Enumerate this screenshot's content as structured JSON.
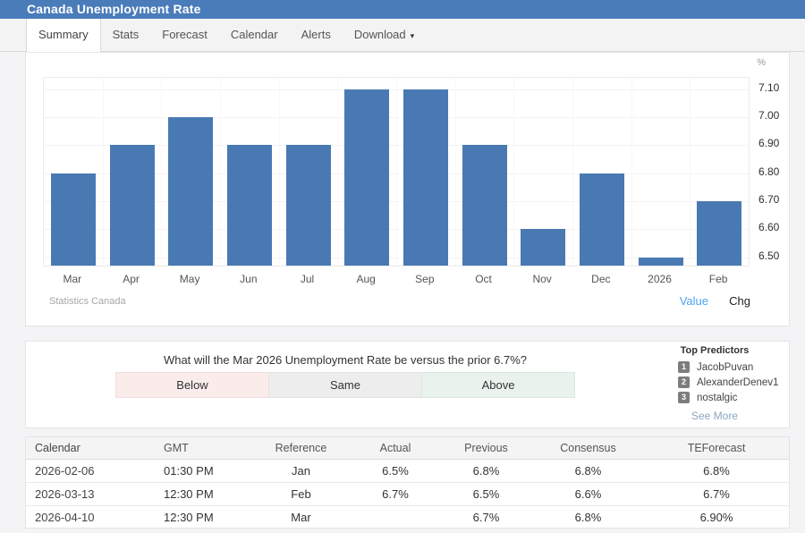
{
  "header": {
    "title": "Canada Unemployment Rate"
  },
  "tabs": [
    {
      "label": "Summary",
      "active": true,
      "has_dropdown": false
    },
    {
      "label": "Stats",
      "active": false,
      "has_dropdown": false
    },
    {
      "label": "Forecast",
      "active": false,
      "has_dropdown": false
    },
    {
      "label": "Calendar",
      "active": false,
      "has_dropdown": false
    },
    {
      "label": "Alerts",
      "active": false,
      "has_dropdown": false
    },
    {
      "label": "Download",
      "active": false,
      "has_dropdown": true
    }
  ],
  "chart_data": {
    "type": "bar",
    "title": "Canada Unemployment Rate",
    "unit": "%",
    "categories": [
      "Mar",
      "Apr",
      "May",
      "Jun",
      "Jul",
      "Aug",
      "Sep",
      "Oct",
      "Nov",
      "Dec",
      "2026",
      "Feb"
    ],
    "values": [
      6.8,
      6.9,
      7.0,
      6.9,
      6.9,
      7.1,
      7.1,
      6.9,
      6.6,
      6.8,
      6.5,
      6.7
    ],
    "ylim": [
      6.47,
      7.14
    ],
    "yticks": [
      {
        "value": 7.1,
        "label": "7.10"
      },
      {
        "value": 7.0,
        "label": "7.00"
      },
      {
        "value": 6.9,
        "label": "6.90"
      },
      {
        "value": 6.8,
        "label": "6.80"
      },
      {
        "value": 6.7,
        "label": "6.70"
      },
      {
        "value": 6.6,
        "label": "6.60"
      },
      {
        "value": 6.5,
        "label": "6.50"
      }
    ],
    "grid": true,
    "legend_position": "none",
    "source": "Statistics Canada"
  },
  "chart_footer": {
    "source": "Statistics Canada",
    "value_label": "Value",
    "chg_label": "Chg"
  },
  "prediction": {
    "question": "What will the Mar 2026 Unemployment Rate be versus the prior 6.7%?",
    "options": [
      "Below",
      "Same",
      "Above"
    ],
    "top_predictors": {
      "title": "Top Predictors",
      "items": [
        {
          "rank": "1",
          "name": "JacobPuvan"
        },
        {
          "rank": "2",
          "name": "AlexanderDenev1"
        },
        {
          "rank": "3",
          "name": "nostalgic"
        }
      ],
      "see_more": "See More"
    }
  },
  "table": {
    "headers": [
      "Calendar",
      "GMT",
      "Reference",
      "Actual",
      "Previous",
      "Consensus",
      "TEForecast"
    ],
    "rows": [
      [
        "2026-02-06",
        "01:30 PM",
        "Jan",
        "6.5%",
        "6.8%",
        "6.8%",
        "6.8%"
      ],
      [
        "2026-03-13",
        "12:30 PM",
        "Feb",
        "6.7%",
        "6.5%",
        "6.6%",
        "6.7%"
      ],
      [
        "2026-04-10",
        "12:30 PM",
        "Mar",
        "",
        "6.7%",
        "6.8%",
        "6.90%"
      ]
    ]
  },
  "colors": {
    "header_bg": "#4a7cba",
    "bar": "#4979b3",
    "value_link": "#4da3f5",
    "see_more_link": "#8ba6c1",
    "option_below_bg": "#fbecec",
    "option_same_bg": "#ededed",
    "option_above_bg": "#eaf2ed",
    "badge_bg": "#7d7d7d"
  }
}
